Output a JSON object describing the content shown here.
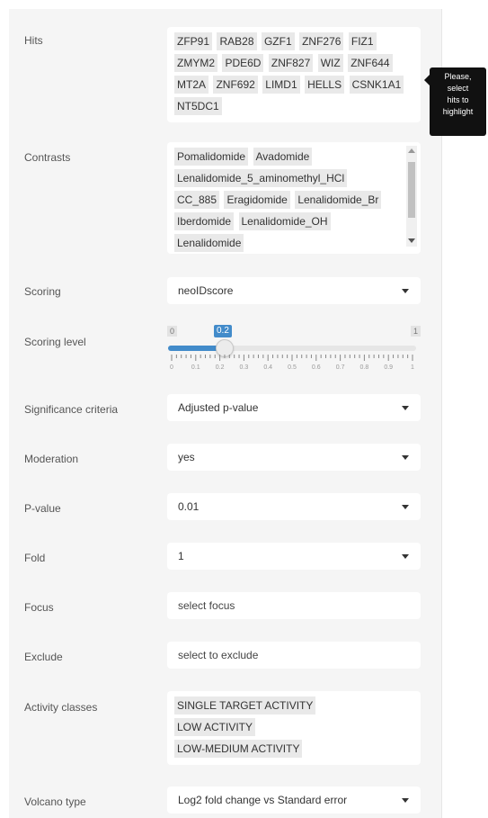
{
  "sidebar": {
    "hits": {
      "label": "Hits",
      "tags": [
        "ZFP91",
        "RAB28",
        "GZF1",
        "ZNF276",
        "FIZ1",
        "ZMYM2",
        "PDE6D",
        "ZNF827",
        "WIZ",
        "ZNF644",
        "MT2A",
        "ZNF692",
        "LIMD1",
        "HELLS",
        "CSNK1A1",
        "NT5DC1"
      ],
      "tooltip": [
        "Please,",
        "select",
        "hits to",
        "highlight"
      ]
    },
    "contrasts": {
      "label": "Contrasts",
      "tags": [
        "Pomalidomide",
        "Avadomide",
        "Lenalidomide_5_aminomethyl_HCl",
        "CC_885",
        "Eragidomide",
        "Lenalidomide_Br",
        "Iberdomide",
        "Lenalidomide_OH",
        "Lenalidomide"
      ]
    },
    "scoring": {
      "label": "Scoring",
      "value": "neoIDscore"
    },
    "scoring_level": {
      "label": "Scoring level",
      "min": "0",
      "max": "1",
      "value": "0.2",
      "value_fraction": 0.2,
      "ticks": [
        "0",
        "0.1",
        "0.2",
        "0.3",
        "0.4",
        "0.5",
        "0.6",
        "0.7",
        "0.8",
        "0.9",
        "1"
      ]
    },
    "significance": {
      "label": "Significance criteria",
      "value": "Adjusted p-value"
    },
    "moderation": {
      "label": "Moderation",
      "value": "yes"
    },
    "pvalue": {
      "label": "P-value",
      "value": "0.01"
    },
    "fold": {
      "label": "Fold",
      "value": "1"
    },
    "focus": {
      "label": "Focus",
      "placeholder": "select focus"
    },
    "exclude": {
      "label": "Exclude",
      "placeholder": "select to exclude"
    },
    "activity": {
      "label": "Activity classes",
      "tags": [
        "SINGLE TARGET ACTIVITY",
        "LOW ACTIVITY",
        "LOW-MEDIUM ACTIVITY"
      ]
    },
    "volcano": {
      "label": "Volcano type",
      "value": "Log2 fold change vs Standard error"
    }
  },
  "colors": {
    "accent": "#428bca",
    "panel": "#f5f5f5",
    "tag": "#e9e9e9",
    "tooltip": "#111111"
  }
}
